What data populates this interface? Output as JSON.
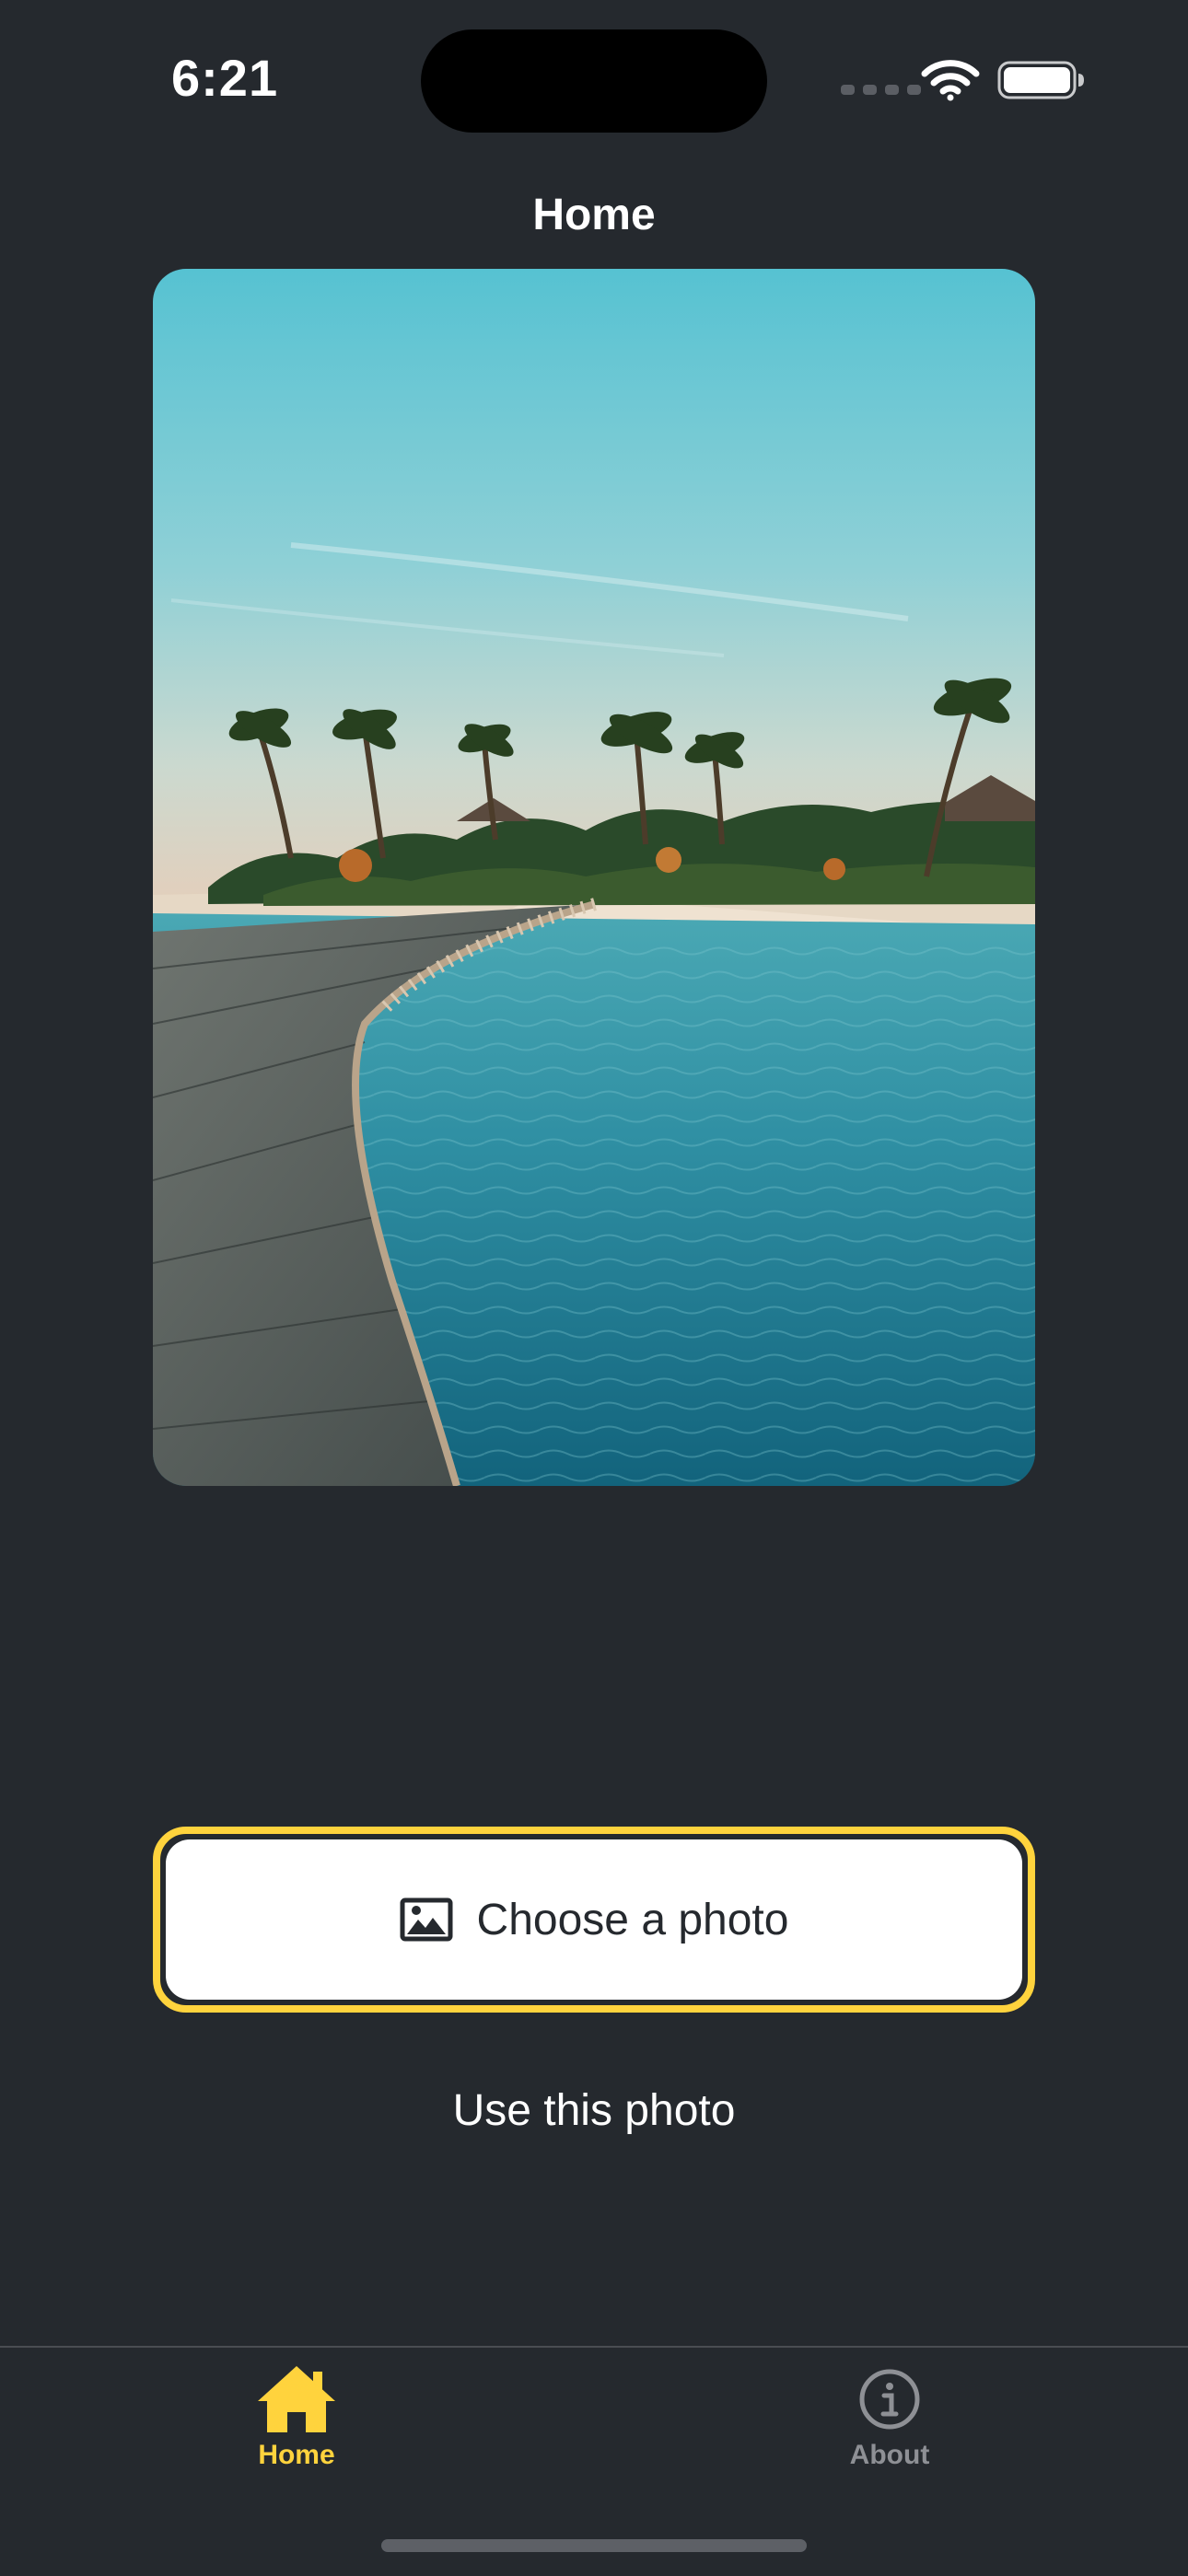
{
  "status_bar": {
    "time": "6:21",
    "icons": [
      "signal-dots-icon",
      "wifi-icon",
      "battery-icon"
    ]
  },
  "nav": {
    "title": "Home"
  },
  "photo": {
    "subject": "beach boardwalk with palm trees"
  },
  "buttons": {
    "choose_photo": {
      "label": "Choose a photo",
      "icon": "picture-icon"
    },
    "use_photo": {
      "label": "Use this photo"
    }
  },
  "tab_bar": {
    "tabs": [
      {
        "label": "Home",
        "icon": "home-icon",
        "active": true
      },
      {
        "label": "About",
        "icon": "info-circle-icon",
        "active": false
      }
    ]
  },
  "colors": {
    "background": "#25292e",
    "accent": "#ffd33d",
    "inactive": "#8e9095",
    "text": "#ffffff",
    "button_text": "#25292e"
  }
}
